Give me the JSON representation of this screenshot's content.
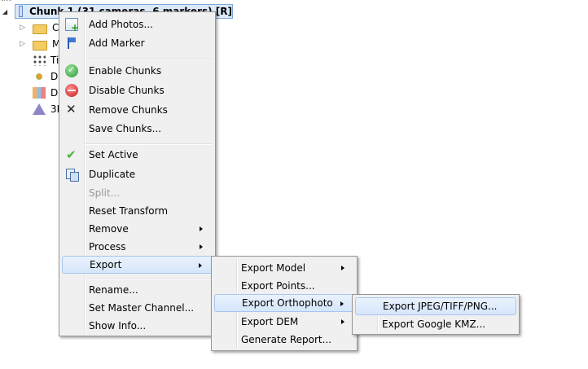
{
  "tree": {
    "chunk_label": "Chunk 1 (31 cameras, 6 markers) [R]",
    "children": [
      {
        "label": "Ca",
        "icon": "folder-icon",
        "expandable": true
      },
      {
        "label": "M",
        "icon": "folder-icon",
        "expandable": true
      },
      {
        "label": "Ti",
        "icon": "tie-points-icon",
        "expandable": false
      },
      {
        "label": "D",
        "icon": "dense-cloud-icon",
        "expandable": false
      },
      {
        "label": "D",
        "icon": "dem-icon",
        "expandable": false
      },
      {
        "label": "3D",
        "icon": "model-3d-icon",
        "expandable": false
      }
    ]
  },
  "context_menu": {
    "items": [
      {
        "label": "Add Photos...",
        "icon": "add-photos-icon"
      },
      {
        "label": "Add Marker",
        "icon": "add-marker-icon"
      },
      {
        "label": "Enable Chunks",
        "icon": "enable-icon"
      },
      {
        "label": "Disable Chunks",
        "icon": "disable-icon"
      },
      {
        "label": "Remove Chunks",
        "icon": "remove-icon"
      },
      {
        "label": "Save Chunks..."
      },
      {
        "label": "Set Active",
        "icon": "check-icon"
      },
      {
        "label": "Duplicate",
        "icon": "duplicate-icon"
      },
      {
        "label": "Split...",
        "disabled": true
      },
      {
        "label": "Reset Transform"
      },
      {
        "label": "Remove",
        "submenu": true
      },
      {
        "label": "Process",
        "submenu": true
      },
      {
        "label": "Export",
        "submenu": true,
        "highlighted": true
      },
      {
        "label": "Rename..."
      },
      {
        "label": "Set Master Channel..."
      },
      {
        "label": "Show Info..."
      }
    ]
  },
  "export_menu": {
    "items": [
      {
        "label": "Export Model",
        "submenu": true
      },
      {
        "label": "Export Points..."
      },
      {
        "label": "Export Orthophoto",
        "submenu": true,
        "highlighted": true
      },
      {
        "label": "Export DEM",
        "submenu": true
      },
      {
        "label": "Generate Report..."
      }
    ]
  },
  "orthophoto_menu": {
    "items": [
      {
        "label": "Export JPEG/TIFF/PNG...",
        "highlighted": true
      },
      {
        "label": "Export Google KMZ..."
      }
    ]
  }
}
